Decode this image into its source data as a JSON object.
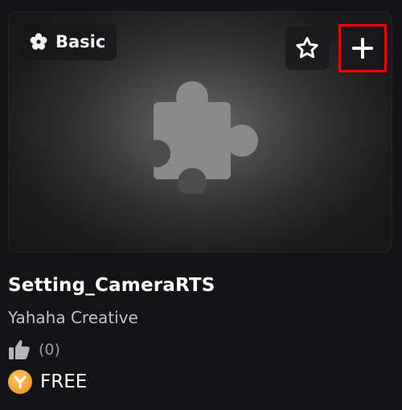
{
  "asset": {
    "tier_label": "Basic",
    "title": "Setting_CameraRTS",
    "creator": "Yahaha Creative",
    "likes_text": "(0)",
    "price_label": "FREE"
  },
  "icons": {
    "tier": "flower-icon",
    "favorite": "star-outline-icon",
    "add": "plus-icon",
    "thumbnail": "puzzle-piece-icon",
    "likes": "thumbs-up-icon",
    "currency": "yahaha-coin-icon"
  },
  "colors": {
    "background": "#141416",
    "highlight_box": "#ff0000",
    "coin": "#f0a33a",
    "puzzle": "#8a8a8a"
  }
}
